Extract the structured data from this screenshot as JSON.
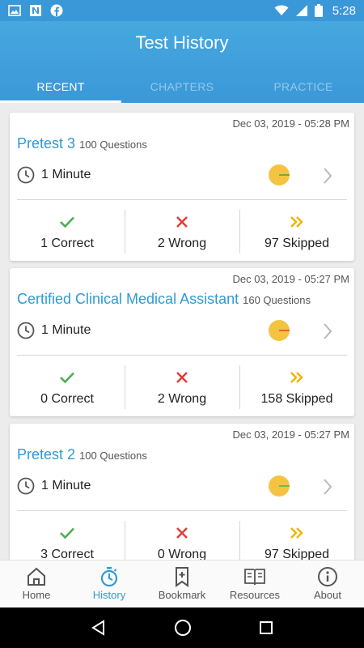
{
  "status": {
    "time": "5:28",
    "left_icons": [
      "image-icon",
      "n-icon",
      "facebook-icon"
    ],
    "right_icons": [
      "wifi-icon",
      "signal-icon",
      "battery-icon"
    ]
  },
  "header": {
    "title": "Test History"
  },
  "tabs": [
    {
      "label": "RECENT",
      "active": true
    },
    {
      "label": "CHAPTERS",
      "active": false
    },
    {
      "label": "PRACTICE",
      "active": false
    }
  ],
  "cards": [
    {
      "date": "Dec 03, 2019 - 05:28 PM",
      "title": "Pretest 3",
      "questions": "100 Questions",
      "duration": "1 Minute",
      "correct": "1 Correct",
      "wrong": "2 Wrong",
      "skipped": "97 Skipped",
      "pie": {
        "correct": 1,
        "wrong": 2,
        "skipped": 97
      }
    },
    {
      "date": "Dec 03, 2019 - 05:27 PM",
      "title": "Certified Clinical Medical Assistant",
      "questions": "160 Questions",
      "duration": "1 Minute",
      "correct": "0 Correct",
      "wrong": "2 Wrong",
      "skipped": "158 Skipped",
      "pie": {
        "correct": 0,
        "wrong": 2,
        "skipped": 158
      }
    },
    {
      "date": "Dec 03, 2019 - 05:27 PM",
      "title": "Pretest 2",
      "questions": "100 Questions",
      "duration": "1 Minute",
      "correct": "3 Correct",
      "wrong": "0 Wrong",
      "skipped": "97 Skipped",
      "pie": {
        "correct": 3,
        "wrong": 0,
        "skipped": 97
      }
    }
  ],
  "nav": [
    {
      "label": "Home",
      "icon": "home-icon",
      "active": false
    },
    {
      "label": "History",
      "icon": "stopwatch-icon",
      "active": true
    },
    {
      "label": "Bookmark",
      "icon": "bookmark-icon",
      "active": false
    },
    {
      "label": "Resources",
      "icon": "book-icon",
      "active": false
    },
    {
      "label": "About",
      "icon": "info-icon",
      "active": false
    }
  ],
  "colors": {
    "accent": "#2f9ad6",
    "header": "#3b98d8",
    "correct": "#4caf50",
    "wrong": "#e53935",
    "skipped": "#f0b400",
    "pie_fill": "#f5c342"
  }
}
